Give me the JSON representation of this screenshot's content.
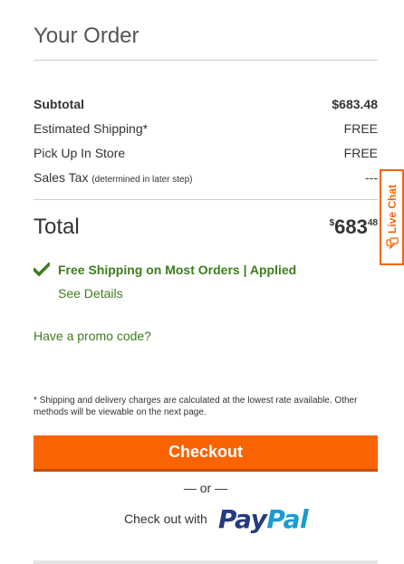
{
  "order": {
    "title": "Your Order",
    "subtotal": {
      "label": "Subtotal",
      "value": "$683.48"
    },
    "shipping": {
      "label": "Estimated Shipping*",
      "value": "FREE"
    },
    "pickup": {
      "label": "Pick Up In Store",
      "value": "FREE"
    },
    "tax": {
      "label": "Sales Tax",
      "note": "(determined in later step)",
      "value": "---"
    },
    "total": {
      "label": "Total",
      "currency": "$",
      "dollars": "683",
      "cents": "48"
    },
    "promo_applied": "Free Shipping on Most Orders | Applied",
    "see_details": "See Details",
    "promo_link": "Have a promo code?",
    "shipping_note": "* Shipping and delivery charges are calculated at the lowest rate available. Other methods will be viewable on the next page.",
    "checkout_label": "Checkout",
    "or_label": "— or —",
    "paypal_prefix": "Check out with",
    "paypal_logo_1": "Pay",
    "paypal_logo_2": "Pal"
  },
  "live_chat": {
    "label": "Live Chat"
  },
  "colors": {
    "accent": "#f96302",
    "green": "#3e7d1e",
    "paypal_dark": "#253b80",
    "paypal_light": "#179bd7"
  }
}
